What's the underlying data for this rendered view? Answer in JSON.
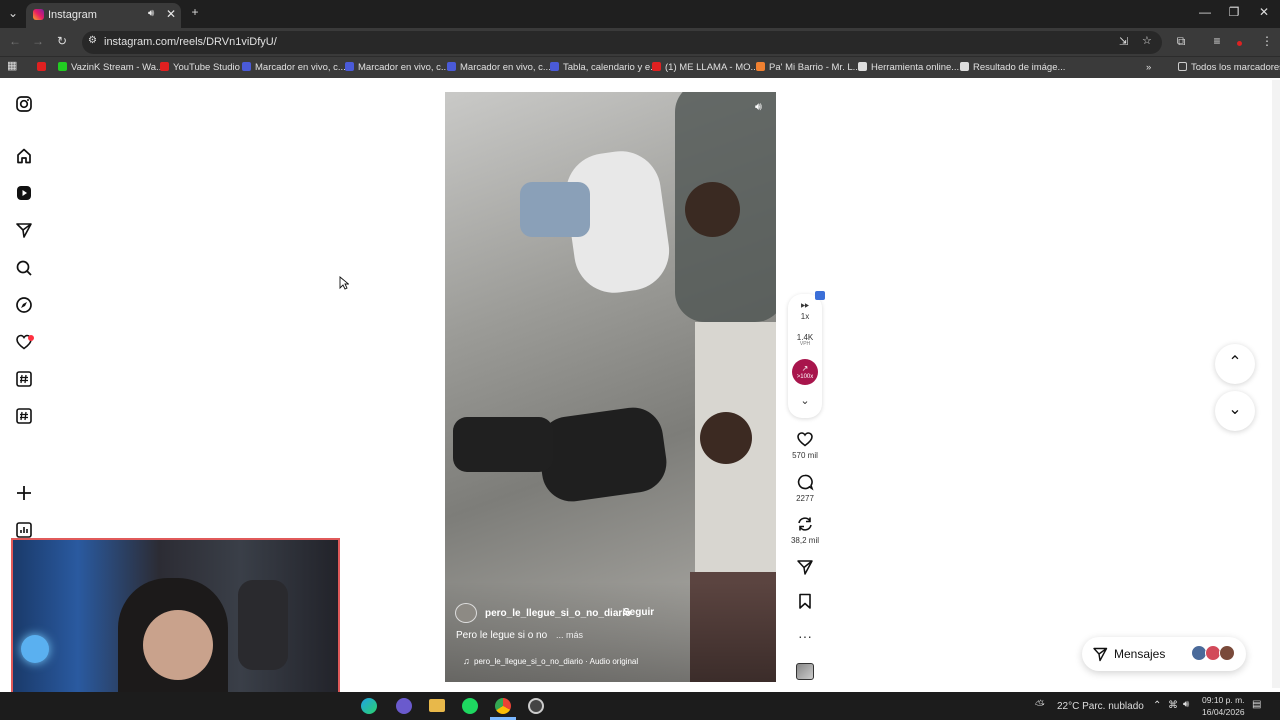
{
  "browser": {
    "tab_title": "Instagram",
    "url": "instagram.com/reels/DRVn1viDfyU/"
  },
  "bookmarks": [
    {
      "label": "",
      "color": "#e02020"
    },
    {
      "label": "VazinK Stream - Wa...",
      "color": "#22cc22"
    },
    {
      "label": "YouTube Studio",
      "color": "#e02020"
    },
    {
      "label": "Marcador en vivo, c...",
      "color": "#4a5ad8"
    },
    {
      "label": "Marcador en vivo, c...",
      "color": "#4a5ad8"
    },
    {
      "label": "Marcador en vivo, c...",
      "color": "#4a5ad8"
    },
    {
      "label": "Tabla, calendario y e...",
      "color": "#4a5ad8"
    },
    {
      "label": "(1) ME LLAMA - MO...",
      "color": "#e02020"
    },
    {
      "label": "Pa' Mi Barrio - Mr. L...",
      "color": "#f08030"
    },
    {
      "label": "Herramienta online...",
      "color": "#dddddd"
    },
    {
      "label": "Resultado de imáge...",
      "color": "#dddddd"
    }
  ],
  "all_bookmarks": "Todos los marcadores",
  "reel": {
    "username": "pero_le_llegue_si_o_no_diario",
    "follow": "Seguir",
    "caption": "Pero le legue si o no",
    "more": "... más",
    "audio": "pero_le_llegue_si_o_no_diario · Audio original"
  },
  "rail": {
    "speed": "1x",
    "views": "1.4K",
    "views_sub": "VPH",
    "trend": ">100x",
    "likes": "570 mil",
    "comments": "2277",
    "reposts": "38,2 mil"
  },
  "messages": "Mensajes",
  "taskbar": {
    "weather": "22°C  Parc. nublado",
    "time": "09:10 p. m.",
    "date": "16/04/2026"
  },
  "colors": {
    "trend_badge": "#a8154c",
    "notif_dot": "#ff3040",
    "webcam_border": "#e05a5a"
  }
}
